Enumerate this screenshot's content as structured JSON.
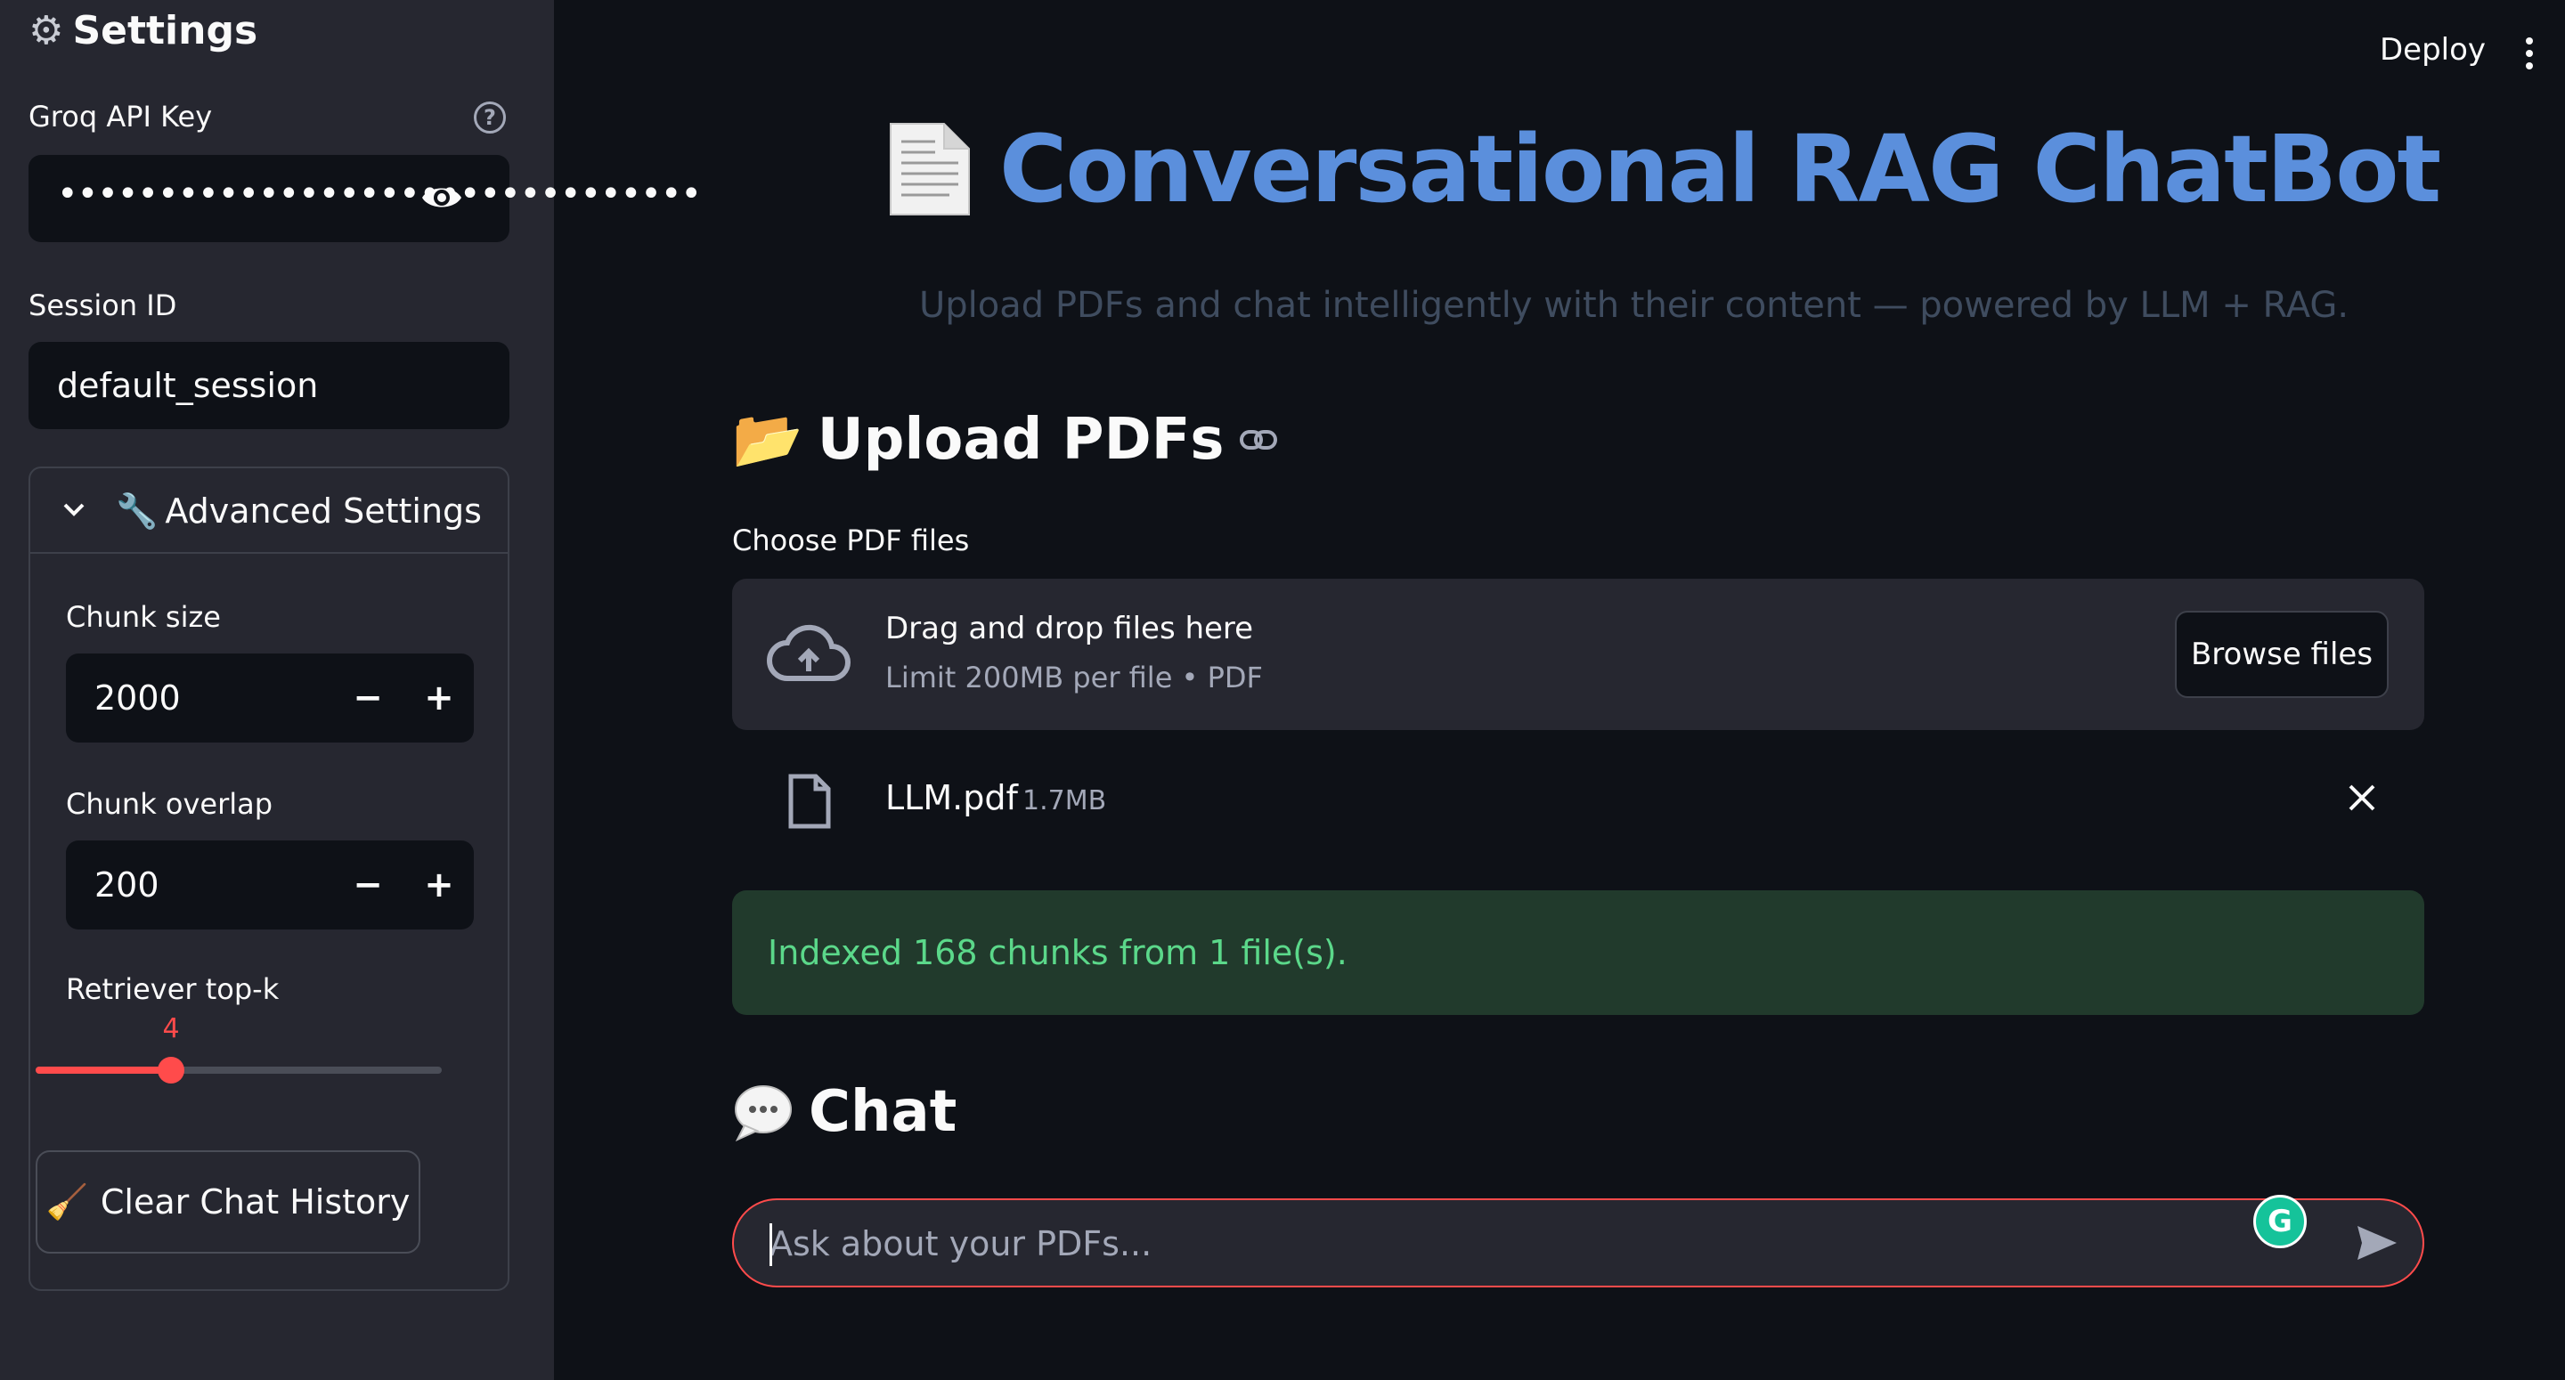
{
  "sidebar": {
    "title": "Settings",
    "api_key": {
      "label": "Groq API Key",
      "value_masked": "••••••••••••••••••••••••••••••••",
      "help": "?"
    },
    "session": {
      "label": "Session ID",
      "value": "default_session"
    },
    "advanced": {
      "title": "Advanced Settings",
      "expanded": true,
      "chunk_size": {
        "label": "Chunk size",
        "value": "2000",
        "minus": "−",
        "plus": "+"
      },
      "chunk_overlap": {
        "label": "Chunk overlap",
        "value": "200",
        "minus": "−",
        "plus": "+"
      },
      "top_k": {
        "label": "Retriever top-k",
        "value": "4",
        "min": 1,
        "max": 10
      },
      "clear_button": "Clear Chat History"
    }
  },
  "header": {
    "deploy": "Deploy"
  },
  "main": {
    "title": "Conversational RAG ChatBot",
    "subtitle": "Upload PDFs and chat intelligently with their content — powered by LLM + RAG.",
    "upload": {
      "heading": "Upload PDFs",
      "label": "Choose PDF files",
      "drop_text": "Drag and drop files here",
      "limit_text": "Limit 200MB per file • PDF",
      "browse": "Browse files",
      "file": {
        "name": "LLM.pdf",
        "size": "1.7MB"
      }
    },
    "status": "Indexed 168 chunks from 1 file(s).",
    "chat": {
      "heading": "Chat",
      "placeholder": "Ask about your PDFs...",
      "grammarly": "G"
    }
  },
  "colors": {
    "background": "#0e1117",
    "sidebar": "#262730",
    "accent": "#ff4b4b",
    "title_blue": "#5b8fdc",
    "success_bg": "#213a2c",
    "success_text": "#5bd88a"
  }
}
